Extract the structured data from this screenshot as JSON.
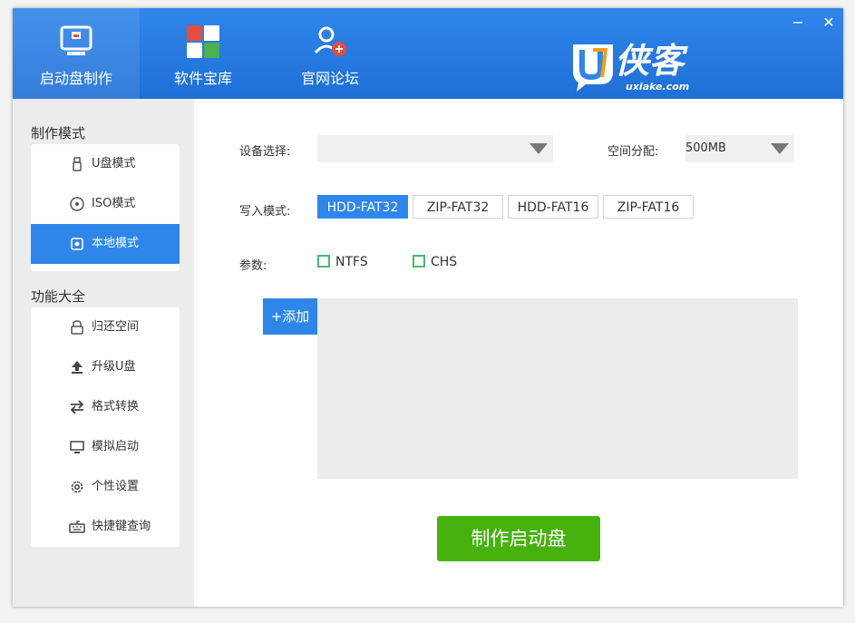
{
  "nav": {
    "items": [
      {
        "label": "启动盘制作",
        "icon": "monitor-usb-icon"
      },
      {
        "label": "软件宝库",
        "icon": "windows-grid-icon"
      },
      {
        "label": "官网论坛",
        "icon": "forum-users-icon"
      }
    ],
    "active": 0
  },
  "window_controls": {
    "minimize": "−",
    "close": "✕"
  },
  "logo": {
    "brand": "侠客",
    "letter": "U",
    "url_text": "uxiake.com"
  },
  "sidebar": {
    "section1_title": "制作模式",
    "modes": [
      {
        "label": "U盘模式",
        "icon": "usb-drive-icon"
      },
      {
        "label": "ISO模式",
        "icon": "disc-icon"
      },
      {
        "label": "本地模式",
        "icon": "local-disk-icon"
      }
    ],
    "active_mode": 2,
    "section2_title": "功能大全",
    "functions": [
      {
        "label": "归还空间",
        "icon": "restore-space-icon"
      },
      {
        "label": "升级U盘",
        "icon": "upgrade-arrow-icon"
      },
      {
        "label": "格式转换",
        "icon": "convert-arrows-icon"
      },
      {
        "label": "模拟启动",
        "icon": "monitor-icon"
      },
      {
        "label": "个性设置",
        "icon": "gear-icon"
      },
      {
        "label": "快捷键查询",
        "icon": "keyboard-icon"
      }
    ]
  },
  "main": {
    "device_label": "设备选择:",
    "device_value": "",
    "space_label": "空间分配:",
    "space_value": "500MB",
    "write_label": "写入模式:",
    "write_modes": [
      "HDD-FAT32",
      "ZIP-FAT32",
      "HDD-FAT16",
      "ZIP-FAT16"
    ],
    "active_write_mode": 0,
    "params_label": "参数:",
    "params": [
      {
        "label": "NTFS",
        "checked": false
      },
      {
        "label": "CHS",
        "checked": false
      }
    ],
    "add_button": "+添加",
    "make_button": "制作启动盘"
  },
  "colors": {
    "accent": "#2f86ea",
    "make": "#47b20e",
    "check": "#4bb96a"
  }
}
